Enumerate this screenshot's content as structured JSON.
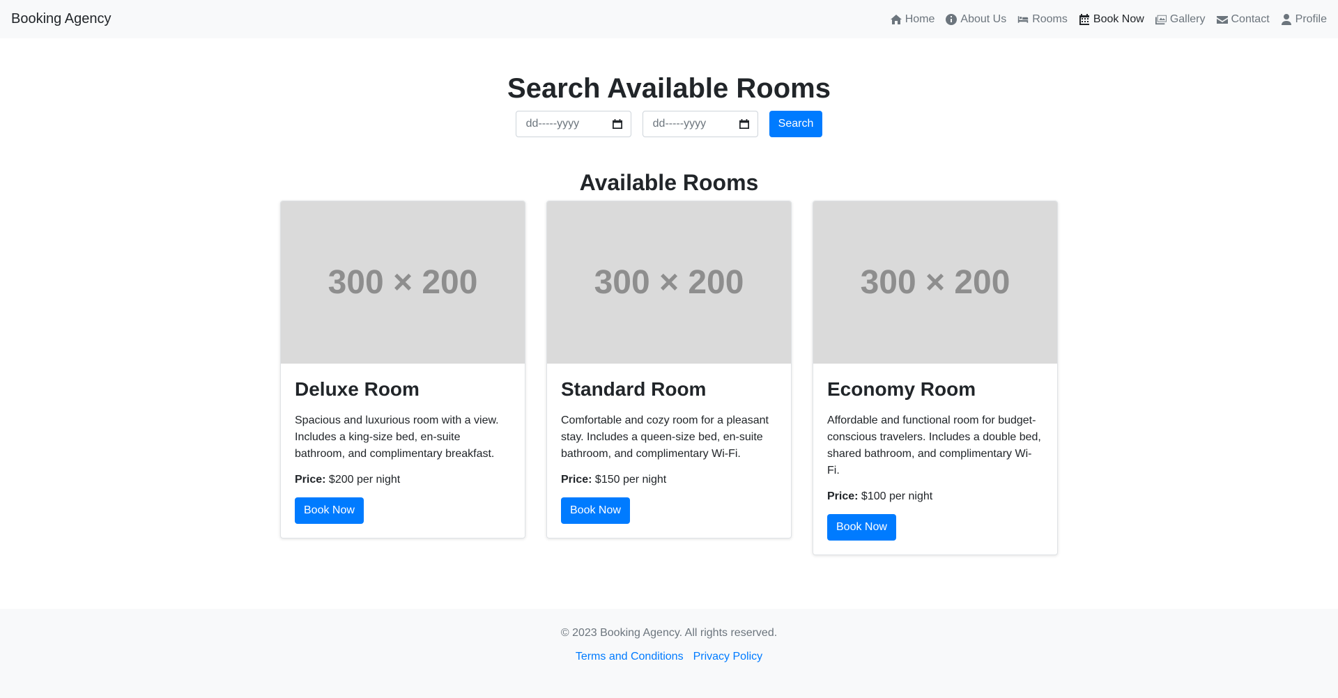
{
  "navbar": {
    "brand": "Booking Agency",
    "items": [
      {
        "label": "Home",
        "icon": "home-icon",
        "active": false
      },
      {
        "label": "About Us",
        "icon": "info-circle-icon",
        "active": false
      },
      {
        "label": "Rooms",
        "icon": "bed-icon",
        "active": false
      },
      {
        "label": "Book Now",
        "icon": "calendar-icon",
        "active": true
      },
      {
        "label": "Gallery",
        "icon": "images-icon",
        "active": false
      },
      {
        "label": "Contact",
        "icon": "envelope-icon",
        "active": false
      },
      {
        "label": "Profile",
        "icon": "user-icon",
        "active": false
      }
    ]
  },
  "search": {
    "title": "Search Available Rooms",
    "checkin_placeholder": "dd-----yyyy",
    "checkout_placeholder": "dd-----yyyy",
    "button_label": "Search"
  },
  "rooms": {
    "title": "Available Rooms",
    "price_label": "Price:",
    "items": [
      {
        "image_text": "300 × 200",
        "name": "Deluxe Room",
        "description": "Spacious and luxurious room with a view. Includes a king-size bed, en-suite bathroom, and complimentary breakfast.",
        "price": "$200 per night",
        "button_label": "Book Now"
      },
      {
        "image_text": "300 × 200",
        "name": "Standard Room",
        "description": "Comfortable and cozy room for a pleasant stay. Includes a queen-size bed, en-suite bathroom, and complimentary Wi-Fi.",
        "price": "$150 per night",
        "button_label": "Book Now"
      },
      {
        "image_text": "300 × 200",
        "name": "Economy Room",
        "description": "Affordable and functional room for budget-conscious travelers. Includes a double bed, shared bathroom, and complimentary Wi-Fi.",
        "price": "$100 per night",
        "button_label": "Book Now"
      }
    ]
  },
  "footer": {
    "copyright": "© 2023 Booking Agency. All rights reserved.",
    "links": [
      "Terms and Conditions",
      "Privacy Policy"
    ]
  },
  "colors": {
    "primary": "#007bff",
    "navbar_bg": "#f8f9fa",
    "placeholder_bg": "#dadada"
  }
}
